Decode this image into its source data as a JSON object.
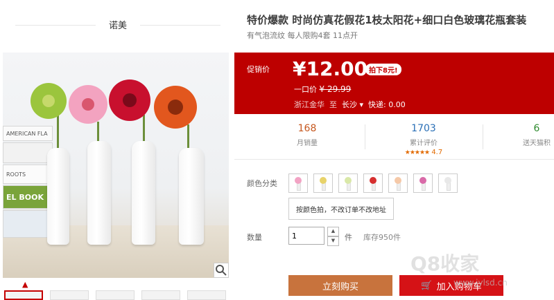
{
  "store": {
    "name": "诺美"
  },
  "product": {
    "title": "特价爆款 时尚仿真花假花1枝太阳花+细口白色玻璃花瓶套装",
    "subtitle": "有气泡流纹 每人限购4套 11点开"
  },
  "gallery": {
    "book_labels": [
      "AMERICAN FLA",
      "ROOTS",
      "EL BOOK"
    ],
    "thumb_count": 5
  },
  "price": {
    "label": "促销价",
    "amount": "¥12.00",
    "badge": "拍下8元!",
    "orig_label": "一口价",
    "orig_amount": "¥ 29.99",
    "ship_from": "浙江金华",
    "ship_to_word": "至",
    "ship_to": "长沙",
    "express": "快递: 0.00",
    "accent": "#bd0000"
  },
  "stats": [
    {
      "value": "168",
      "label": "月销量"
    },
    {
      "value": "1703",
      "label": "累计评价",
      "rating": "4.7",
      "stars": "★★★★★"
    },
    {
      "value": "6",
      "label": "送天猫积"
    }
  ],
  "options": {
    "color_label": "颜色分类",
    "swatch_colors": [
      "#f2a3c4",
      "#e8d36a",
      "#d9e8a8",
      "#d62f2f",
      "#f5c9a8",
      "#d96aa8",
      "#e8e8e8"
    ],
    "tip": "按颜色拍，不改订单不改地址"
  },
  "quantity": {
    "label": "数量",
    "value": "1",
    "unit": "件",
    "stock": "库存950件"
  },
  "actions": {
    "buy": "立刻购买",
    "cart": "加入购物车"
  },
  "watermark": {
    "main": "Q8收家",
    "sub": "www.jylsd.cn"
  }
}
